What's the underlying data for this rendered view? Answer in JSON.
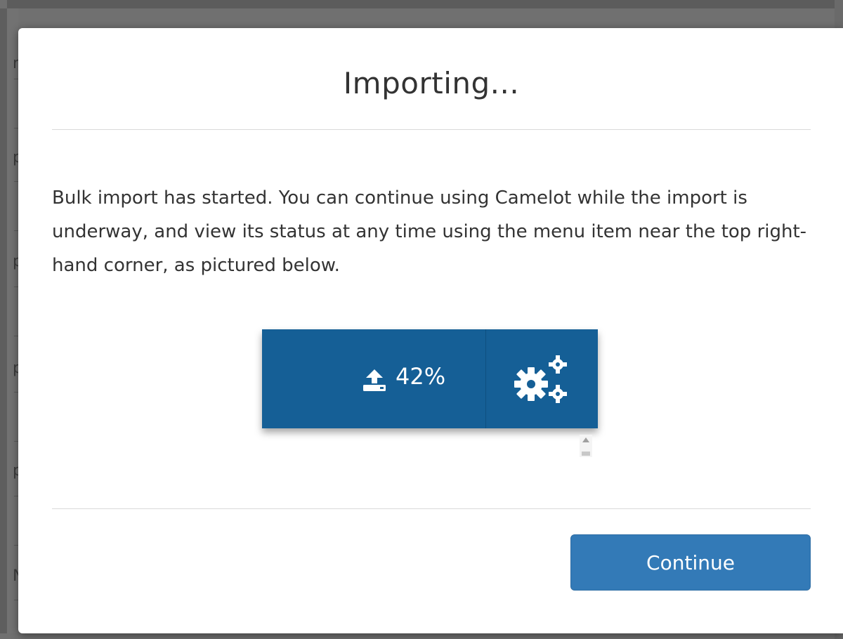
{
  "background": {
    "letters": [
      "r",
      "p",
      "p",
      "p",
      "p",
      "N"
    ]
  },
  "dialog": {
    "title": "Importing...",
    "message": "Bulk import has started. You can continue using Camelot while the import is underway, and view its status at any time using the menu item near the top right-hand corner, as pictured below.",
    "illustration": {
      "import_progress": "42%",
      "progress_icon": "upload-icon",
      "settings_icon": "cogs-icon",
      "bar_color": "#155f96"
    },
    "continue_label": "Continue",
    "accent_color": "#337ab7"
  }
}
